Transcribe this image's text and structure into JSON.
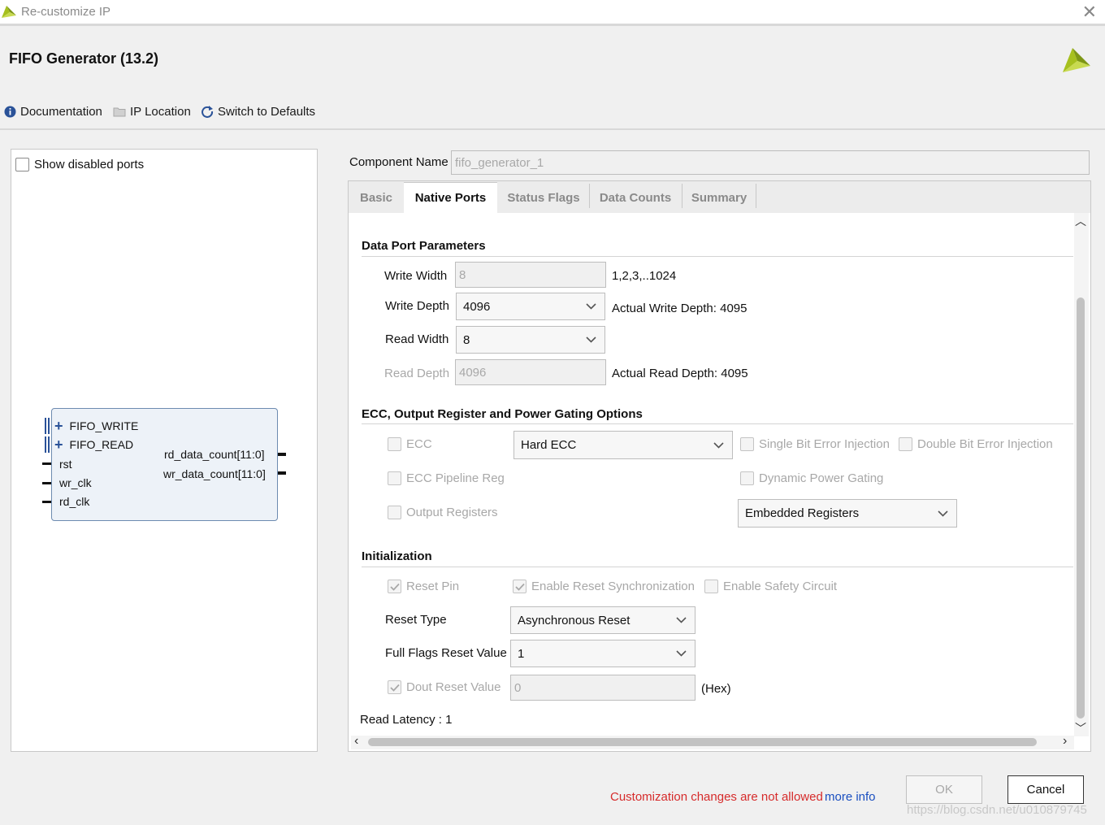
{
  "window": {
    "title": "Re-customize IP"
  },
  "header": {
    "title": "FIFO Generator (13.2)"
  },
  "toolbar": {
    "documentation": "Documentation",
    "ip_location": "IP Location",
    "switch_defaults": "Switch to Defaults"
  },
  "left": {
    "show_disabled_ports": "Show disabled ports",
    "ports_in": [
      "FIFO_WRITE",
      "FIFO_READ"
    ],
    "pins_left": [
      "rst",
      "wr_clk",
      "rd_clk"
    ],
    "pins_right": [
      "rd_data_count[11:0]",
      "wr_data_count[11:0]"
    ]
  },
  "component": {
    "label": "Component Name",
    "value": "fifo_generator_1"
  },
  "tabs": [
    "Basic",
    "Native Ports",
    "Status Flags",
    "Data Counts",
    "Summary"
  ],
  "data_port": {
    "title": "Data Port Parameters",
    "write_width_label": "Write Width",
    "write_width_value": "8",
    "write_width_hint": "1,2,3,..1024",
    "write_depth_label": "Write Depth",
    "write_depth_value": "4096",
    "write_depth_hint": "Actual Write Depth: 4095",
    "read_width_label": "Read Width",
    "read_width_value": "8",
    "read_depth_label": "Read Depth",
    "read_depth_value": "4096",
    "read_depth_hint": "Actual Read Depth: 4095"
  },
  "ecc": {
    "title": "ECC, Output Register and Power Gating Options",
    "ecc_label": "ECC",
    "ecc_select": "Hard ECC",
    "single_bit": "Single Bit Error Injection",
    "double_bit": "Double Bit Error Injection",
    "pipeline_reg": "ECC Pipeline Reg",
    "dynamic_power": "Dynamic Power Gating",
    "output_registers": "Output Registers",
    "output_registers_select": "Embedded Registers"
  },
  "init": {
    "title": "Initialization",
    "reset_pin": "Reset Pin",
    "enable_reset_sync": "Enable Reset Synchronization",
    "enable_safety": "Enable Safety Circuit",
    "reset_type_label": "Reset Type",
    "reset_type_value": "Asynchronous Reset",
    "full_flags_label": "Full Flags Reset Value",
    "full_flags_value": "1",
    "dout_reset_label": "Dout Reset Value",
    "dout_reset_value": "0",
    "dout_reset_unit": "(Hex)",
    "read_latency": "Read Latency : 1"
  },
  "footer": {
    "warning": "Customization changes are not allowed",
    "more_info": "more info",
    "ok": "OK",
    "cancel": "Cancel",
    "watermark": "https://blog.csdn.net/u010879745"
  },
  "colors": {
    "warning": "#d62b2b",
    "link": "#1a4fc0",
    "logo": "#a6c01e"
  }
}
